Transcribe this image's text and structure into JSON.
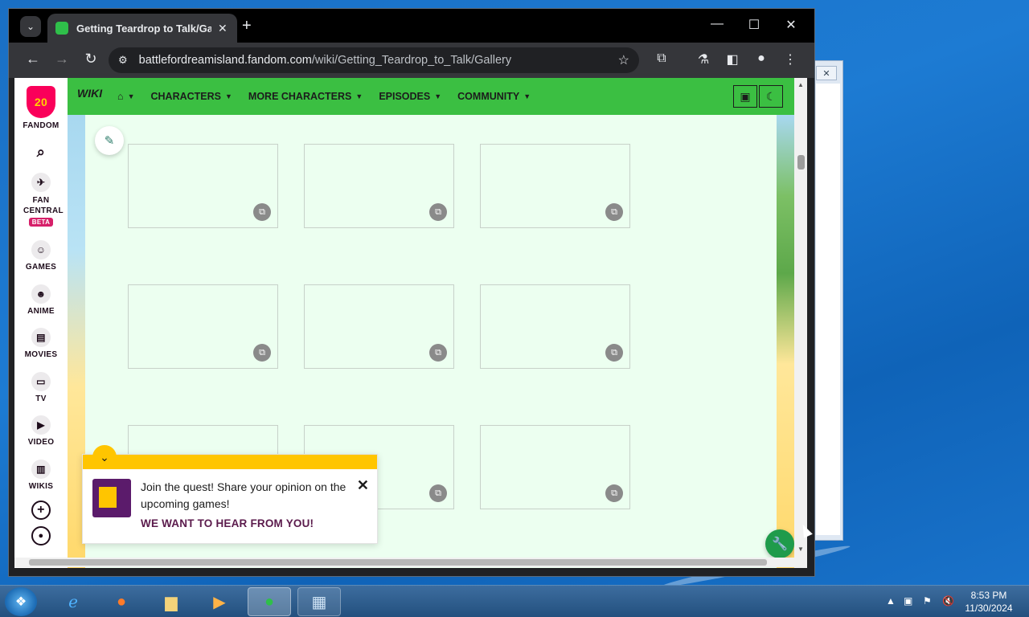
{
  "browser": {
    "tab_title": "Getting Teardrop to Talk/Galle",
    "url_host": "battlefordreamisland.fandom.com",
    "url_path": "/wiki/Getting_Teardrop_to_Talk/Gallery"
  },
  "fandom_rail": {
    "logo_text": "20",
    "items": [
      {
        "label": "FANDOM"
      },
      {
        "label": "FAN CENTRAL",
        "badge": "BETA"
      },
      {
        "label": "GAMES"
      },
      {
        "label": "ANIME"
      },
      {
        "label": "MOVIES"
      },
      {
        "label": "TV"
      },
      {
        "label": "VIDEO"
      },
      {
        "label": "WIKIS"
      }
    ]
  },
  "wiki_nav": {
    "logo": "WIKI",
    "items": [
      "CHARACTERS",
      "MORE CHARACTERS",
      "EPISODES",
      "COMMUNITY"
    ]
  },
  "gallery": {
    "thumbnails": 9
  },
  "promo": {
    "text": "Join the quest! Share your opinion on the upcoming games!",
    "cta": "WE WANT TO HEAR FROM YOU!"
  },
  "taskbar": {
    "time": "8:53 PM",
    "date": "11/30/2024"
  },
  "colors": {
    "wiki_nav": "#3bbf42",
    "content_bg": "#ecfff0",
    "fandom_pink": "#fa005a",
    "promo_yellow": "#ffc500"
  }
}
